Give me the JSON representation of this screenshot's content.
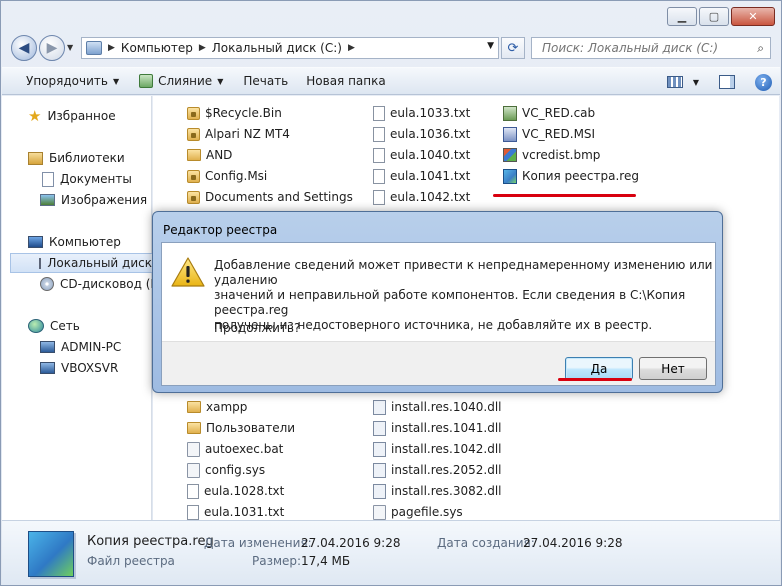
{
  "address": {
    "crumbs": [
      "Компьютер",
      "Локальный диск (C:)"
    ],
    "search_placeholder": "Поиск: Локальный диск (C:)"
  },
  "toolbar": {
    "organize": "Упорядочить",
    "merge": "Слияние",
    "print": "Печать",
    "new_folder": "Новая папка"
  },
  "nav": {
    "favorites": "Избранное",
    "libraries": "Библиотеки",
    "documents": "Документы",
    "images": "Изображения",
    "computer": "Компьютер",
    "local_disk": "Локальный диск",
    "cd_drive": "CD-дисковод (D:",
    "network": "Сеть",
    "host1": "ADMIN-PC",
    "host2": "VBOXSVR"
  },
  "files": {
    "col1_top": [
      {
        "name": "$Recycle.Bin",
        "icon": "locked-folder-icon"
      },
      {
        "name": "Alpari NZ MT4",
        "icon": "locked-folder-icon"
      },
      {
        "name": "AND",
        "icon": "folder-icon"
      },
      {
        "name": "Config.Msi",
        "icon": "locked-folder-icon"
      },
      {
        "name": "Documents and Settings",
        "icon": "locked-folder-icon"
      }
    ],
    "col1_bottom": [
      {
        "name": "xampp",
        "icon": "folder-icon"
      },
      {
        "name": "Пользователи",
        "icon": "folder-icon"
      },
      {
        "name": "autoexec.bat",
        "icon": "settings-file-icon"
      },
      {
        "name": "config.sys",
        "icon": "settings-file-icon"
      },
      {
        "name": "eula.1028.txt",
        "icon": "text-file-icon"
      },
      {
        "name": "eula.1031.txt",
        "icon": "text-file-icon"
      }
    ],
    "col2_top": [
      {
        "name": "eula.1033.txt",
        "icon": "text-file-icon"
      },
      {
        "name": "eula.1036.txt",
        "icon": "text-file-icon"
      },
      {
        "name": "eula.1040.txt",
        "icon": "text-file-icon"
      },
      {
        "name": "eula.1041.txt",
        "icon": "text-file-icon"
      },
      {
        "name": "eula.1042.txt",
        "icon": "text-file-icon"
      }
    ],
    "col2_bottom": [
      {
        "name": "install.res.1040.dll",
        "icon": "dll-file-icon"
      },
      {
        "name": "install.res.1041.dll",
        "icon": "dll-file-icon"
      },
      {
        "name": "install.res.1042.dll",
        "icon": "dll-file-icon"
      },
      {
        "name": "install.res.2052.dll",
        "icon": "dll-file-icon"
      },
      {
        "name": "install.res.3082.dll",
        "icon": "dll-file-icon"
      },
      {
        "name": "pagefile.sys",
        "icon": "settings-file-icon"
      }
    ],
    "col3": [
      {
        "name": "VC_RED.cab",
        "icon": "cab-file-icon"
      },
      {
        "name": "VC_RED.MSI",
        "icon": "msi-file-icon"
      },
      {
        "name": "vcredist.bmp",
        "icon": "bmp-file-icon"
      },
      {
        "name": "Копия реестра.reg",
        "icon": "reg-file-icon"
      }
    ]
  },
  "dialog": {
    "title": "Редактор реестра",
    "message_line1": "Добавление сведений может привести к непреднамеренному изменению или удалению",
    "message_line2": "значений и неправильной работе компонентов. Если сведения в C:\\Копия реестра.reg",
    "message_line3": "получены из недостоверного источника, не добавляйте их в реестр.",
    "question": "Продолжить?",
    "yes": "Да",
    "no": "Нет"
  },
  "details": {
    "file_name": "Копия реестра.reg",
    "file_type": "Файл реестра",
    "modified_label": "Дата изменения:",
    "modified_value": "27.04.2016 9:28",
    "created_label": "Дата создания:",
    "created_value": "27.04.2016 9:28",
    "size_label": "Размер:",
    "size_value": "17,4 МБ"
  },
  "colors": {
    "highlight_underline": "#d8000f",
    "dialog_frame": "#9ebbe2"
  }
}
